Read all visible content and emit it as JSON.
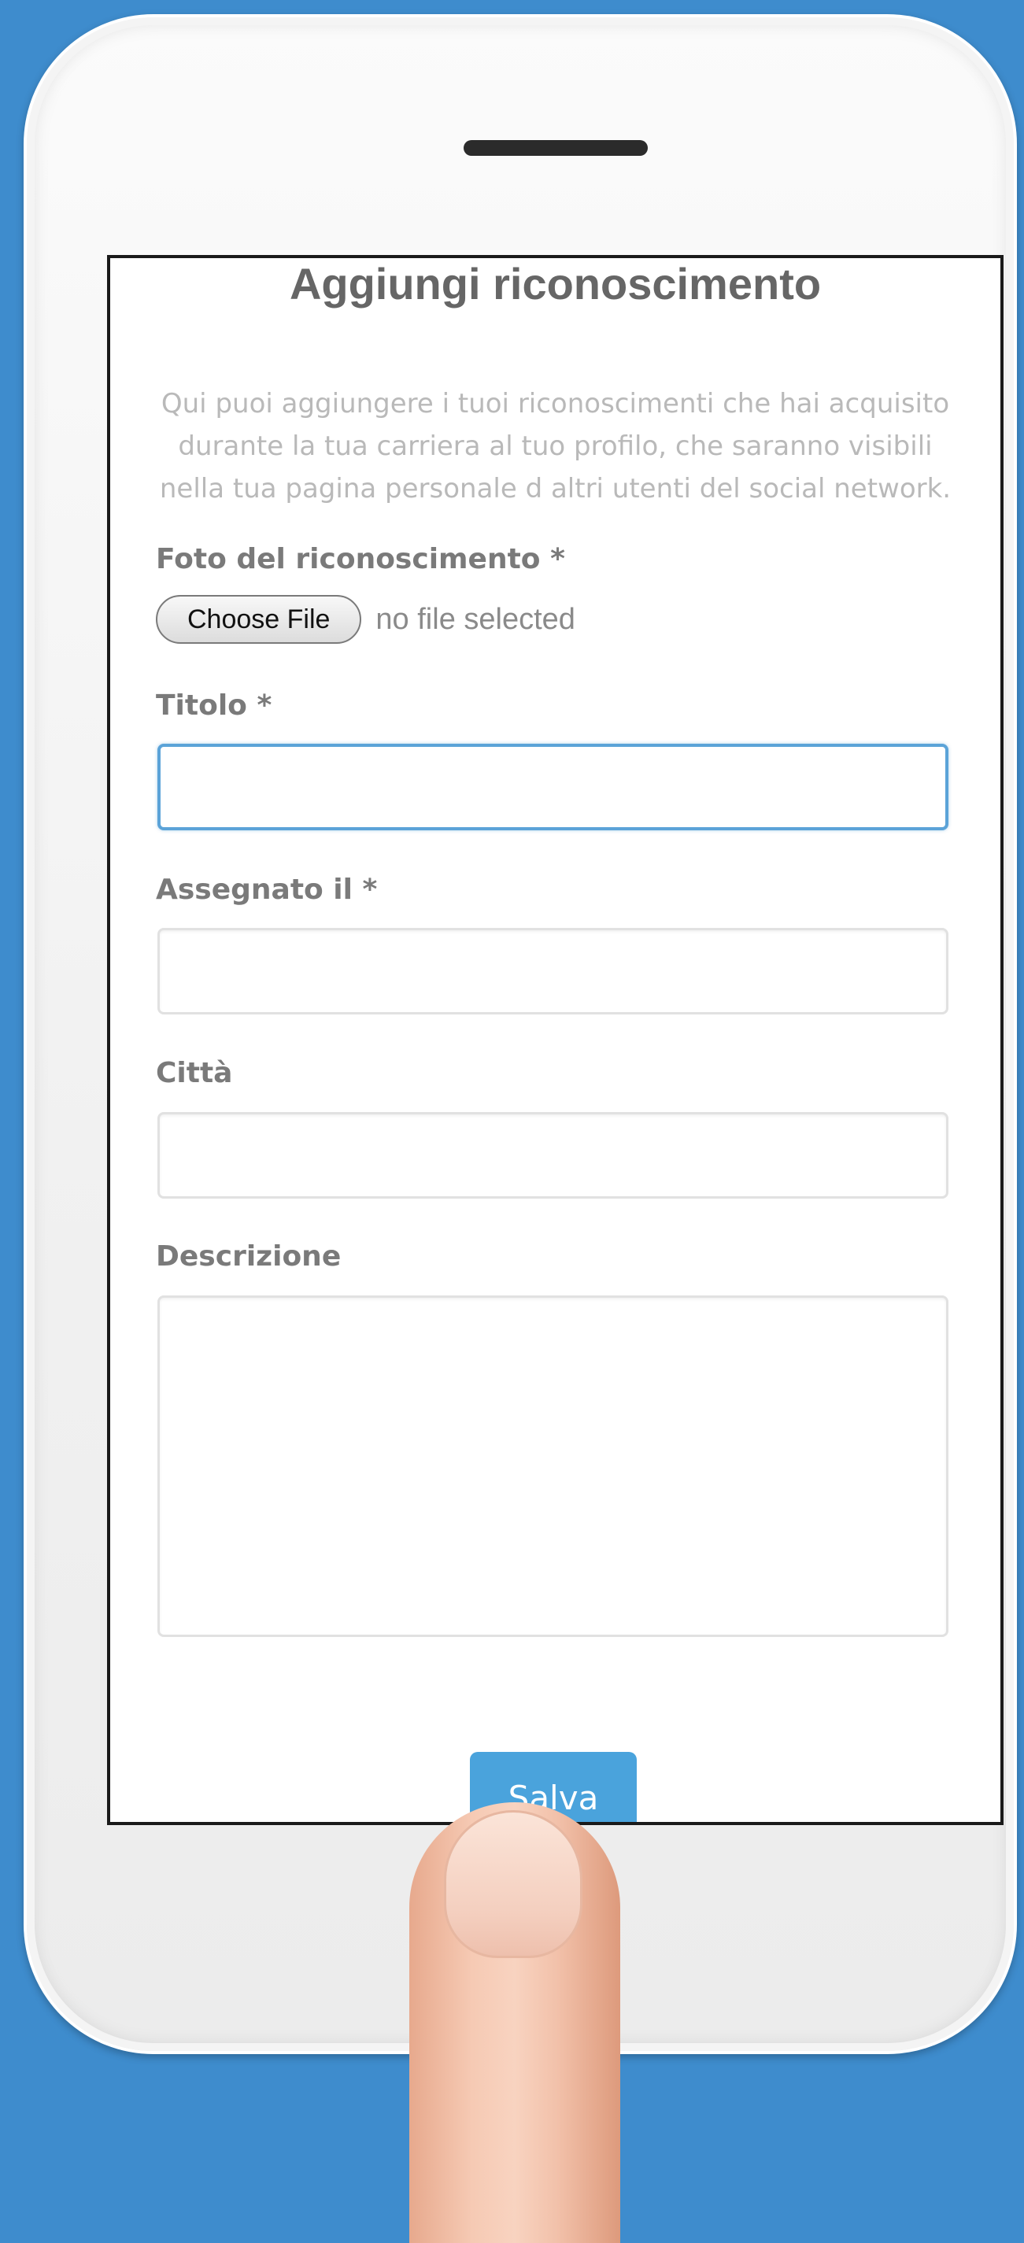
{
  "page": {
    "title": "Aggiungi riconoscimento",
    "intro": "Qui puoi aggiungere i tuoi riconoscimenti che hai acquisito durante la tua carriera al tuo profilo, che saranno visibili nella tua pagina personale d altri utenti del social network."
  },
  "form": {
    "photo_label": "Foto del riconoscimento *",
    "choose_file_label": "Choose File",
    "file_status": "no file selected",
    "title_label": "Titolo *",
    "title_value": "",
    "assigned_label": "Assegnato il *",
    "assigned_value": "",
    "city_label": "Città",
    "city_value": "",
    "description_label": "Descrizione",
    "description_value": "",
    "save_label": "Salva"
  },
  "colors": {
    "background": "#3e8ccd",
    "accent": "#4aa3dc",
    "focus_border": "#5ba3d8"
  }
}
